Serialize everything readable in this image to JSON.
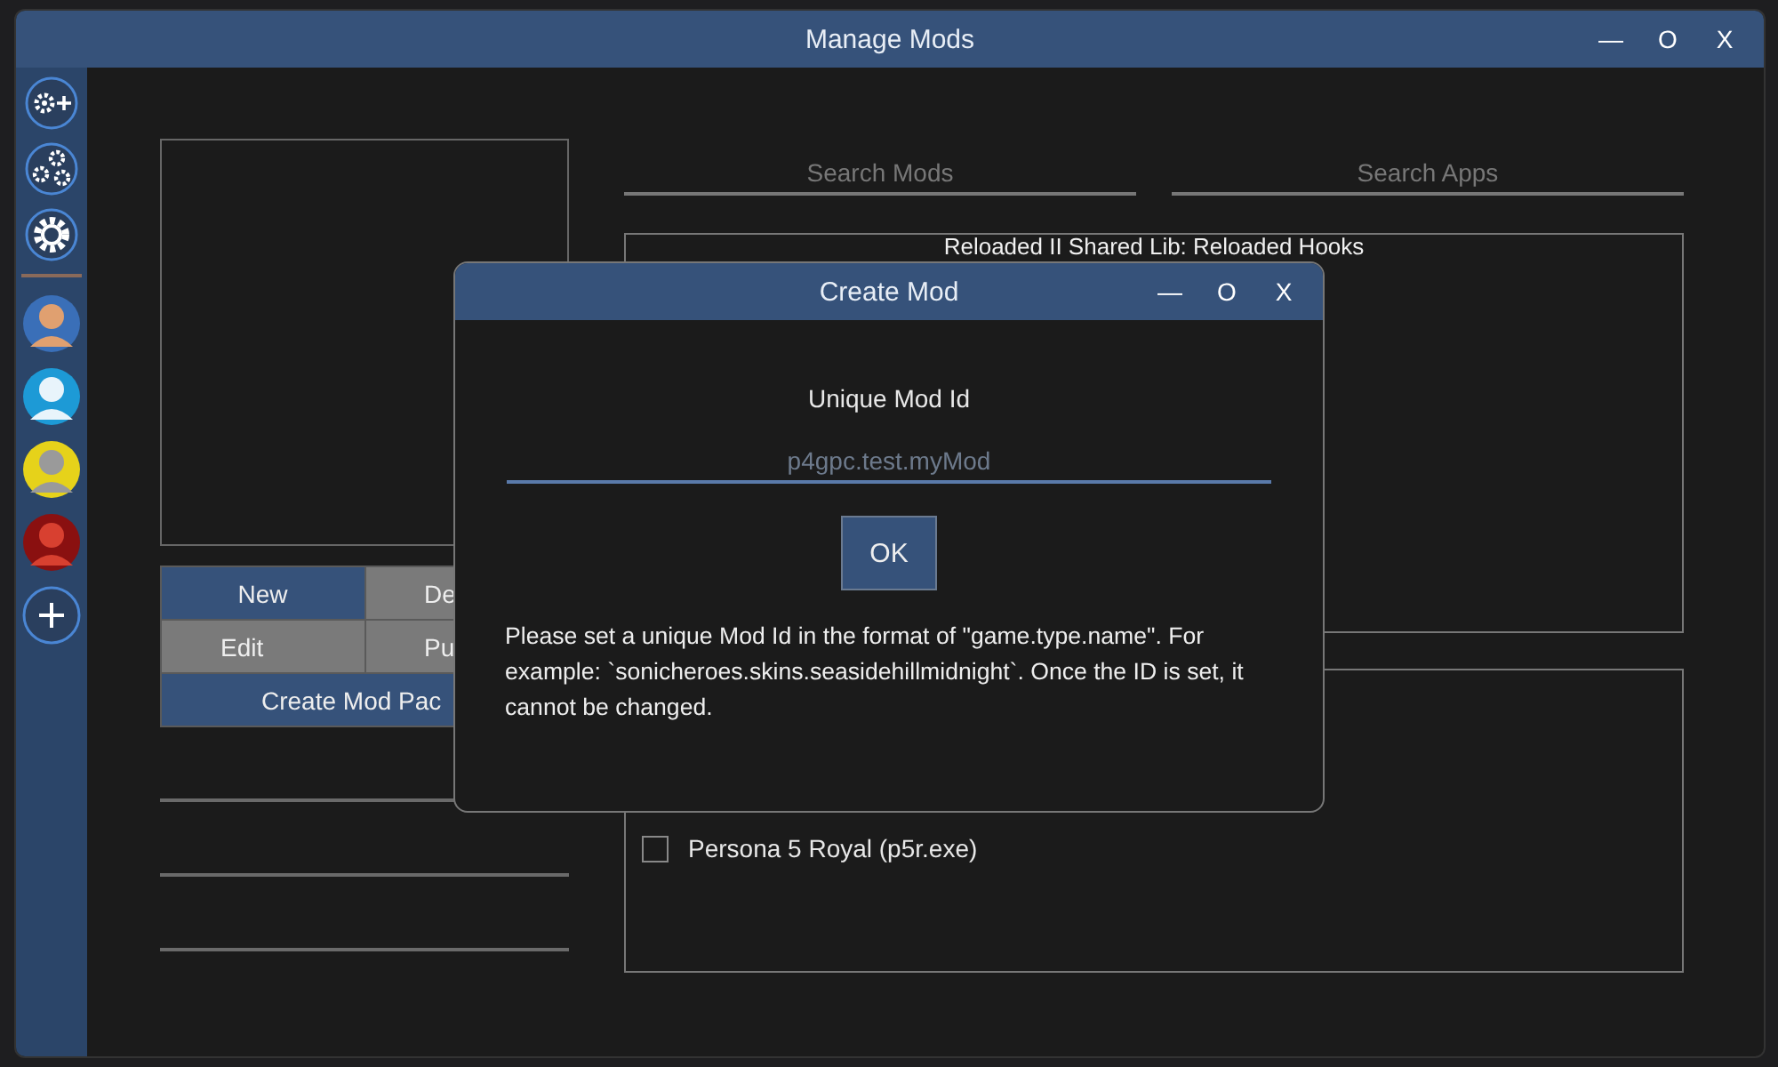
{
  "window": {
    "title": "Manage Mods",
    "controls": [
      "—",
      "O",
      "X"
    ]
  },
  "sidebar": {
    "tools": [
      {
        "kind": "gear-plus"
      },
      {
        "kind": "gears"
      },
      {
        "kind": "gear"
      }
    ],
    "add": {
      "kind": "plus"
    }
  },
  "editor": {
    "buttons": [
      {
        "label": "New",
        "kind": "primary"
      },
      {
        "label": "De",
        "kind": "secondary"
      },
      {
        "label": "Edit",
        "kind": "secondary"
      },
      {
        "label": "Pu",
        "kind": "secondary"
      },
      {
        "label": "Create Mod Pac",
        "kind": "wide"
      }
    ]
  },
  "search": [
    {
      "placeholder": "Search Mods"
    },
    {
      "placeholder": "Search Apps"
    }
  ],
  "mods": [
    "Reloaded II Shared Lib: Reloaded Hooks"
  ],
  "apps": [
    {
      "label": "Persona 5 Royal (p5r.exe)",
      "checked": false
    }
  ],
  "dialog": {
    "title": "Create Mod",
    "controls": [
      "—",
      "O",
      "X"
    ],
    "label": "Unique Mod Id",
    "placeholder": "p4gpc.test.myMod",
    "button": "OK",
    "help": "Please set a unique Mod Id in the format of \"game.type.name\". For example: `sonicheroes.skins.seasidehillmidnight`. Once the ID is set, it cannot be changed."
  }
}
